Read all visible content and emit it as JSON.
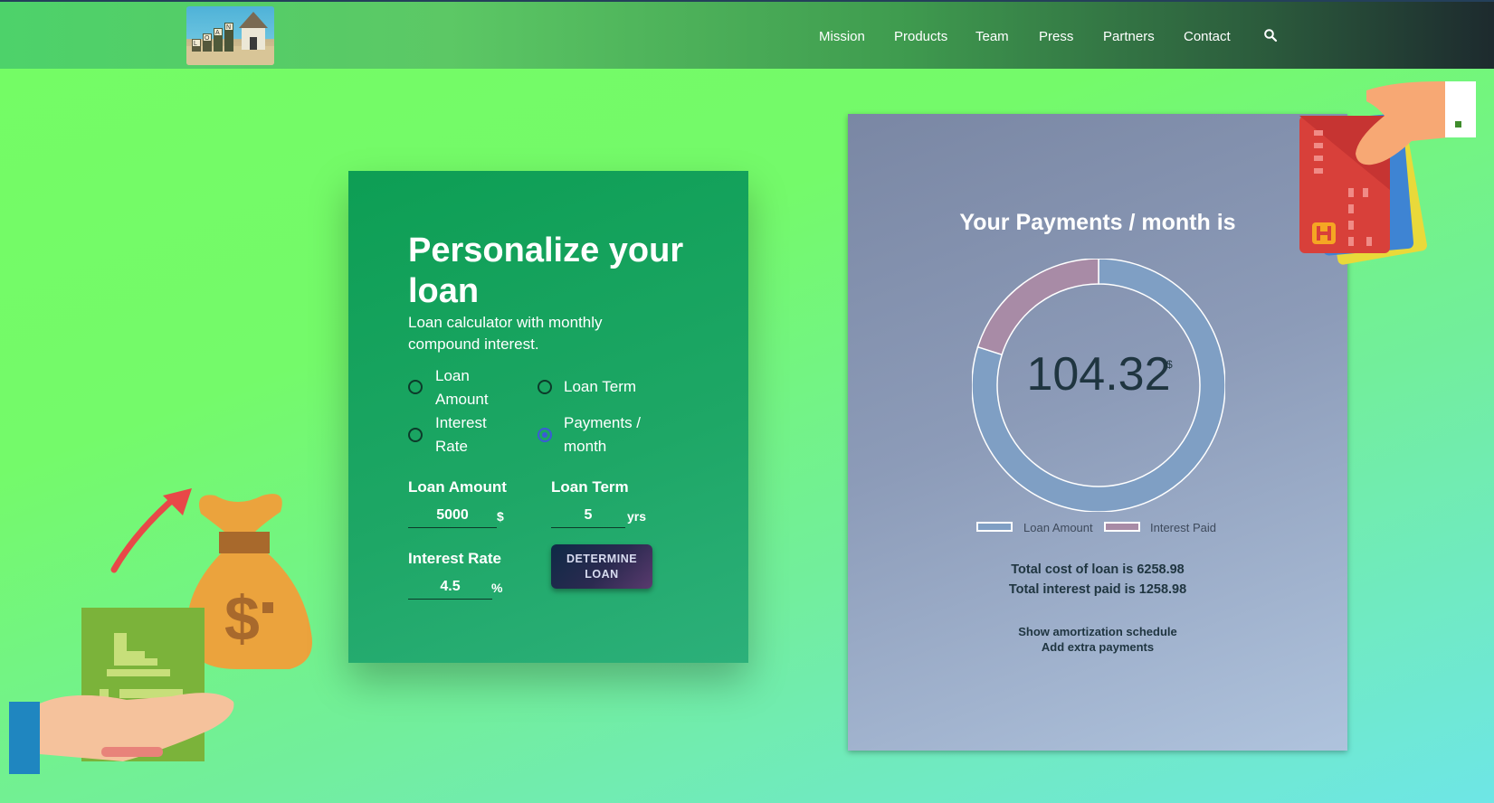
{
  "nav": {
    "items": [
      "Mission",
      "Products",
      "Team",
      "Press",
      "Partners",
      "Contact"
    ],
    "search_icon": "search-icon"
  },
  "logo": {
    "text": "LOAN"
  },
  "calculator": {
    "title": "Personalize your loan",
    "subtitle": "Loan calculator with monthly compound interest.",
    "solve_for": {
      "options": [
        "Loan Amount",
        "Loan Term",
        "Interest Rate",
        "Payments / month"
      ],
      "selected": "Payments / month"
    },
    "loan_amount": {
      "label": "Loan Amount",
      "value": "5000",
      "unit": "$"
    },
    "loan_term": {
      "label": "Loan Term",
      "value": "5",
      "unit": "yrs"
    },
    "interest_rate": {
      "label": "Interest Rate",
      "value": "4.5",
      "unit": "%"
    },
    "button": "DETERMINE LOAN"
  },
  "result": {
    "title": "Your Payments / month is",
    "value": "104.32",
    "currency": "$",
    "chart_data": {
      "type": "pie",
      "variant": "doughnut",
      "slices": [
        {
          "name": "Loan Amount",
          "value": 5000,
          "color": "#7f9fc4"
        },
        {
          "name": "Interest Paid",
          "value": 1258.98,
          "color": "#a88ba6"
        }
      ],
      "legend": "bottom"
    },
    "total_cost": "Total cost of loan is 6258.98",
    "total_interest": "Total interest paid is 1258.98",
    "links": [
      "Show amortization schedule",
      "Add extra payments"
    ]
  },
  "colors": {
    "form_card": "#15a35c",
    "button_dark": "#0e2a46",
    "radio_selected": "#3b5bd6"
  }
}
